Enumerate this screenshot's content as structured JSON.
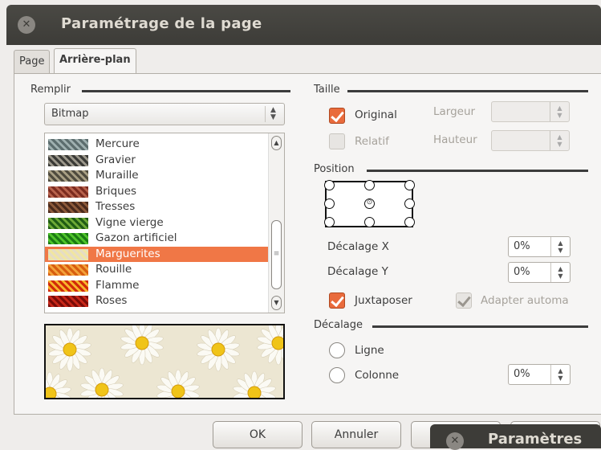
{
  "window": {
    "title": "Paramétrage de la page",
    "close_glyph": "✕"
  },
  "tabs": [
    {
      "label": "Page"
    },
    {
      "label": "Arrière-plan",
      "active": true
    }
  ],
  "fill": {
    "section_label": "Remplir",
    "type_value": "Bitmap",
    "items": [
      {
        "label": "Mercure",
        "colors": [
          "#5c6d6e",
          "#9fb0b0"
        ]
      },
      {
        "label": "Gravier",
        "colors": [
          "#3a3a36",
          "#9c988c"
        ]
      },
      {
        "label": "Muraille",
        "colors": [
          "#4f4b3e",
          "#a89f84"
        ]
      },
      {
        "label": "Briques",
        "colors": [
          "#7c2c20",
          "#b8624c"
        ]
      },
      {
        "label": "Tresses",
        "colors": [
          "#4a2a1c",
          "#8d5a3b"
        ]
      },
      {
        "label": "Vigne vierge",
        "colors": [
          "#1f5c14",
          "#6eaa36"
        ]
      },
      {
        "label": "Gazon artificiel",
        "colors": [
          "#1a7a12",
          "#4fc42a"
        ]
      },
      {
        "label": "Marguerites",
        "colors": [
          "#e5dcc4",
          "#f1e6a0"
        ],
        "selected": true
      },
      {
        "label": "Rouille",
        "colors": [
          "#d85e10",
          "#f3a23a"
        ]
      },
      {
        "label": "Flamme",
        "colors": [
          "#d22a08",
          "#f7b62c"
        ]
      },
      {
        "label": "Roses",
        "colors": [
          "#7a0c08",
          "#c8281a"
        ]
      }
    ]
  },
  "size": {
    "section_label": "Taille",
    "original_label": "Original",
    "original_checked": true,
    "relative_label": "Relatif",
    "relative_checked": false,
    "width_label": "Largeur",
    "height_label": "Hauteur"
  },
  "position": {
    "section_label": "Position",
    "offset_x_label": "Décalage X",
    "offset_x_value": "0%",
    "offset_y_label": "Décalage Y",
    "offset_y_value": "0%",
    "tile_label": "Juxtaposer",
    "tile_checked": true,
    "autofit_label": "Adapter automa",
    "autofit_checked": true
  },
  "offset": {
    "section_label": "Décalage",
    "row_label": "Ligne",
    "column_label": "Colonne",
    "value": "0%"
  },
  "buttons": {
    "ok": "OK",
    "cancel": "Annuler"
  },
  "overlay_window": {
    "title": "Paramètres",
    "close_glyph": "✕"
  },
  "icons": {
    "spin_up": "▲",
    "spin_down": "▼",
    "scroll_up": "▲",
    "scroll_down": "▼",
    "scroll_grip": "≡",
    "center_marker": "⊙"
  }
}
